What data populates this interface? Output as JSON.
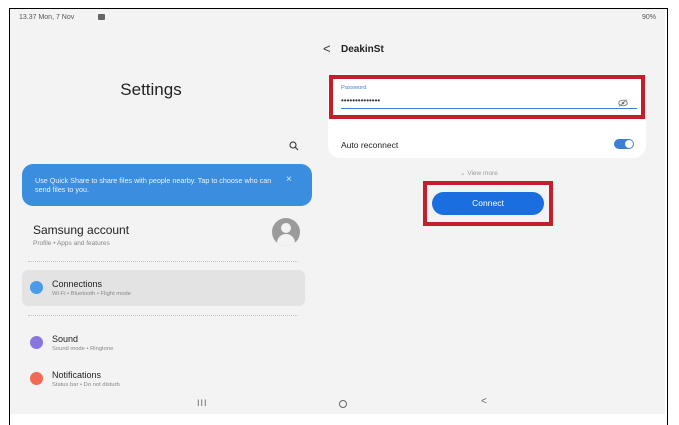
{
  "status_bar": {
    "time": "13.37  Mon, 7 Nov",
    "battery": "90%"
  },
  "left": {
    "title": "Settings",
    "quick_share": {
      "text": "Use Quick Share to share files with people nearby. Tap to choose who can send files to you.",
      "close": "×"
    },
    "account": {
      "title": "Samsung account",
      "subtitle": "Profile  •  Apps and features"
    },
    "items": [
      {
        "title": "Connections",
        "subtitle": "Wi-Fi  •  Bluetooth  •  Flight mode",
        "icon": "wifi-icon",
        "color": "#4a9be8"
      },
      {
        "title": "Sound",
        "subtitle": "Sound mode  •  Ringtone",
        "icon": "sound-icon",
        "color": "#8a76e0"
      },
      {
        "title": "Notifications",
        "subtitle": "Status bar  •  Do not disturb",
        "icon": "notifications-icon",
        "color": "#f06a55"
      }
    ]
  },
  "right": {
    "back": "<",
    "network_name": "DeakinSt",
    "password_label": "Password",
    "password_value": "••••••••••••••",
    "auto_reconnect_label": "Auto reconnect",
    "auto_reconnect_on": true,
    "view_more": "⌄  View more",
    "connect_label": "Connect"
  },
  "nav": {
    "recents": "III",
    "back": "<"
  },
  "colors": {
    "accent": "#1a6ee0",
    "highlight": "#c41e2a",
    "banner": "#3b8de0"
  }
}
